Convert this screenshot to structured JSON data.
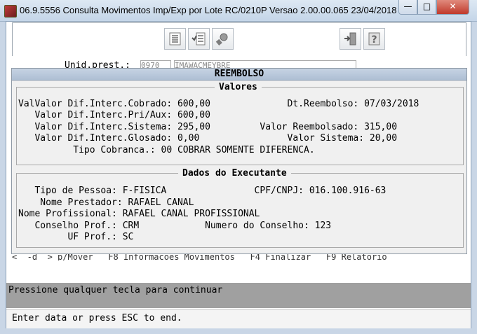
{
  "window": {
    "title": "06.9.5556 Consulta Movimentos Imp/Exp por Lote RC/0210P Versao 2.00.00.065 23/04/2018 - 1...",
    "controls": {
      "minimize": "—",
      "maximize": "□",
      "close": "✕"
    }
  },
  "toolbar": {
    "icons": [
      "list-icon",
      "checklist-icon",
      "search-tool-icon",
      "exit-door-icon",
      "help-icon"
    ]
  },
  "background_form": {
    "unid_label": "Unid.prest.:",
    "unid_code": "0970",
    "unid_name": "IMAWACMEYBRE",
    "command_line": "<  -d  > p/Mover   F8 Informacoes Movimentos   F4 Finalizar   F9 Relatorio"
  },
  "dialog": {
    "title": "REEMBOLSO",
    "valores": {
      "legend": "Valores",
      "lines": [
        "ValValor Dif.Interc.Cobrado: 600,00              Dt.Reembolso: 07/03/2018",
        "   Valor Dif.Interc.Pri/Aux: 600,00",
        "   Valor Dif.Interc.Sistema: 295,00         Valor Reembolsado: 315,00",
        "   Valor Dif.Interc.Glosado: 0,00                Valor Sistema: 20,00",
        "          Tipo Cobranca.: 00 COBRAR SOMENTE DIFERENCA."
      ]
    },
    "executante": {
      "legend": "Dados do Executante",
      "lines": [
        "   Tipo de Pessoa: F-FISICA                CPF/CNPJ: 016.100.916-63",
        "    Nome Prestador: RAFAEL CANAL",
        "Nome Profissional: RAFAEL CANAL PROFISSIONAL",
        "   Conselho Prof.: CRM            Numero do Conselho: 123",
        "         UF Prof.: SC"
      ]
    }
  },
  "prompt": "Pressione qualquer tecla para continuar",
  "status": "Enter data or press ESC to end."
}
